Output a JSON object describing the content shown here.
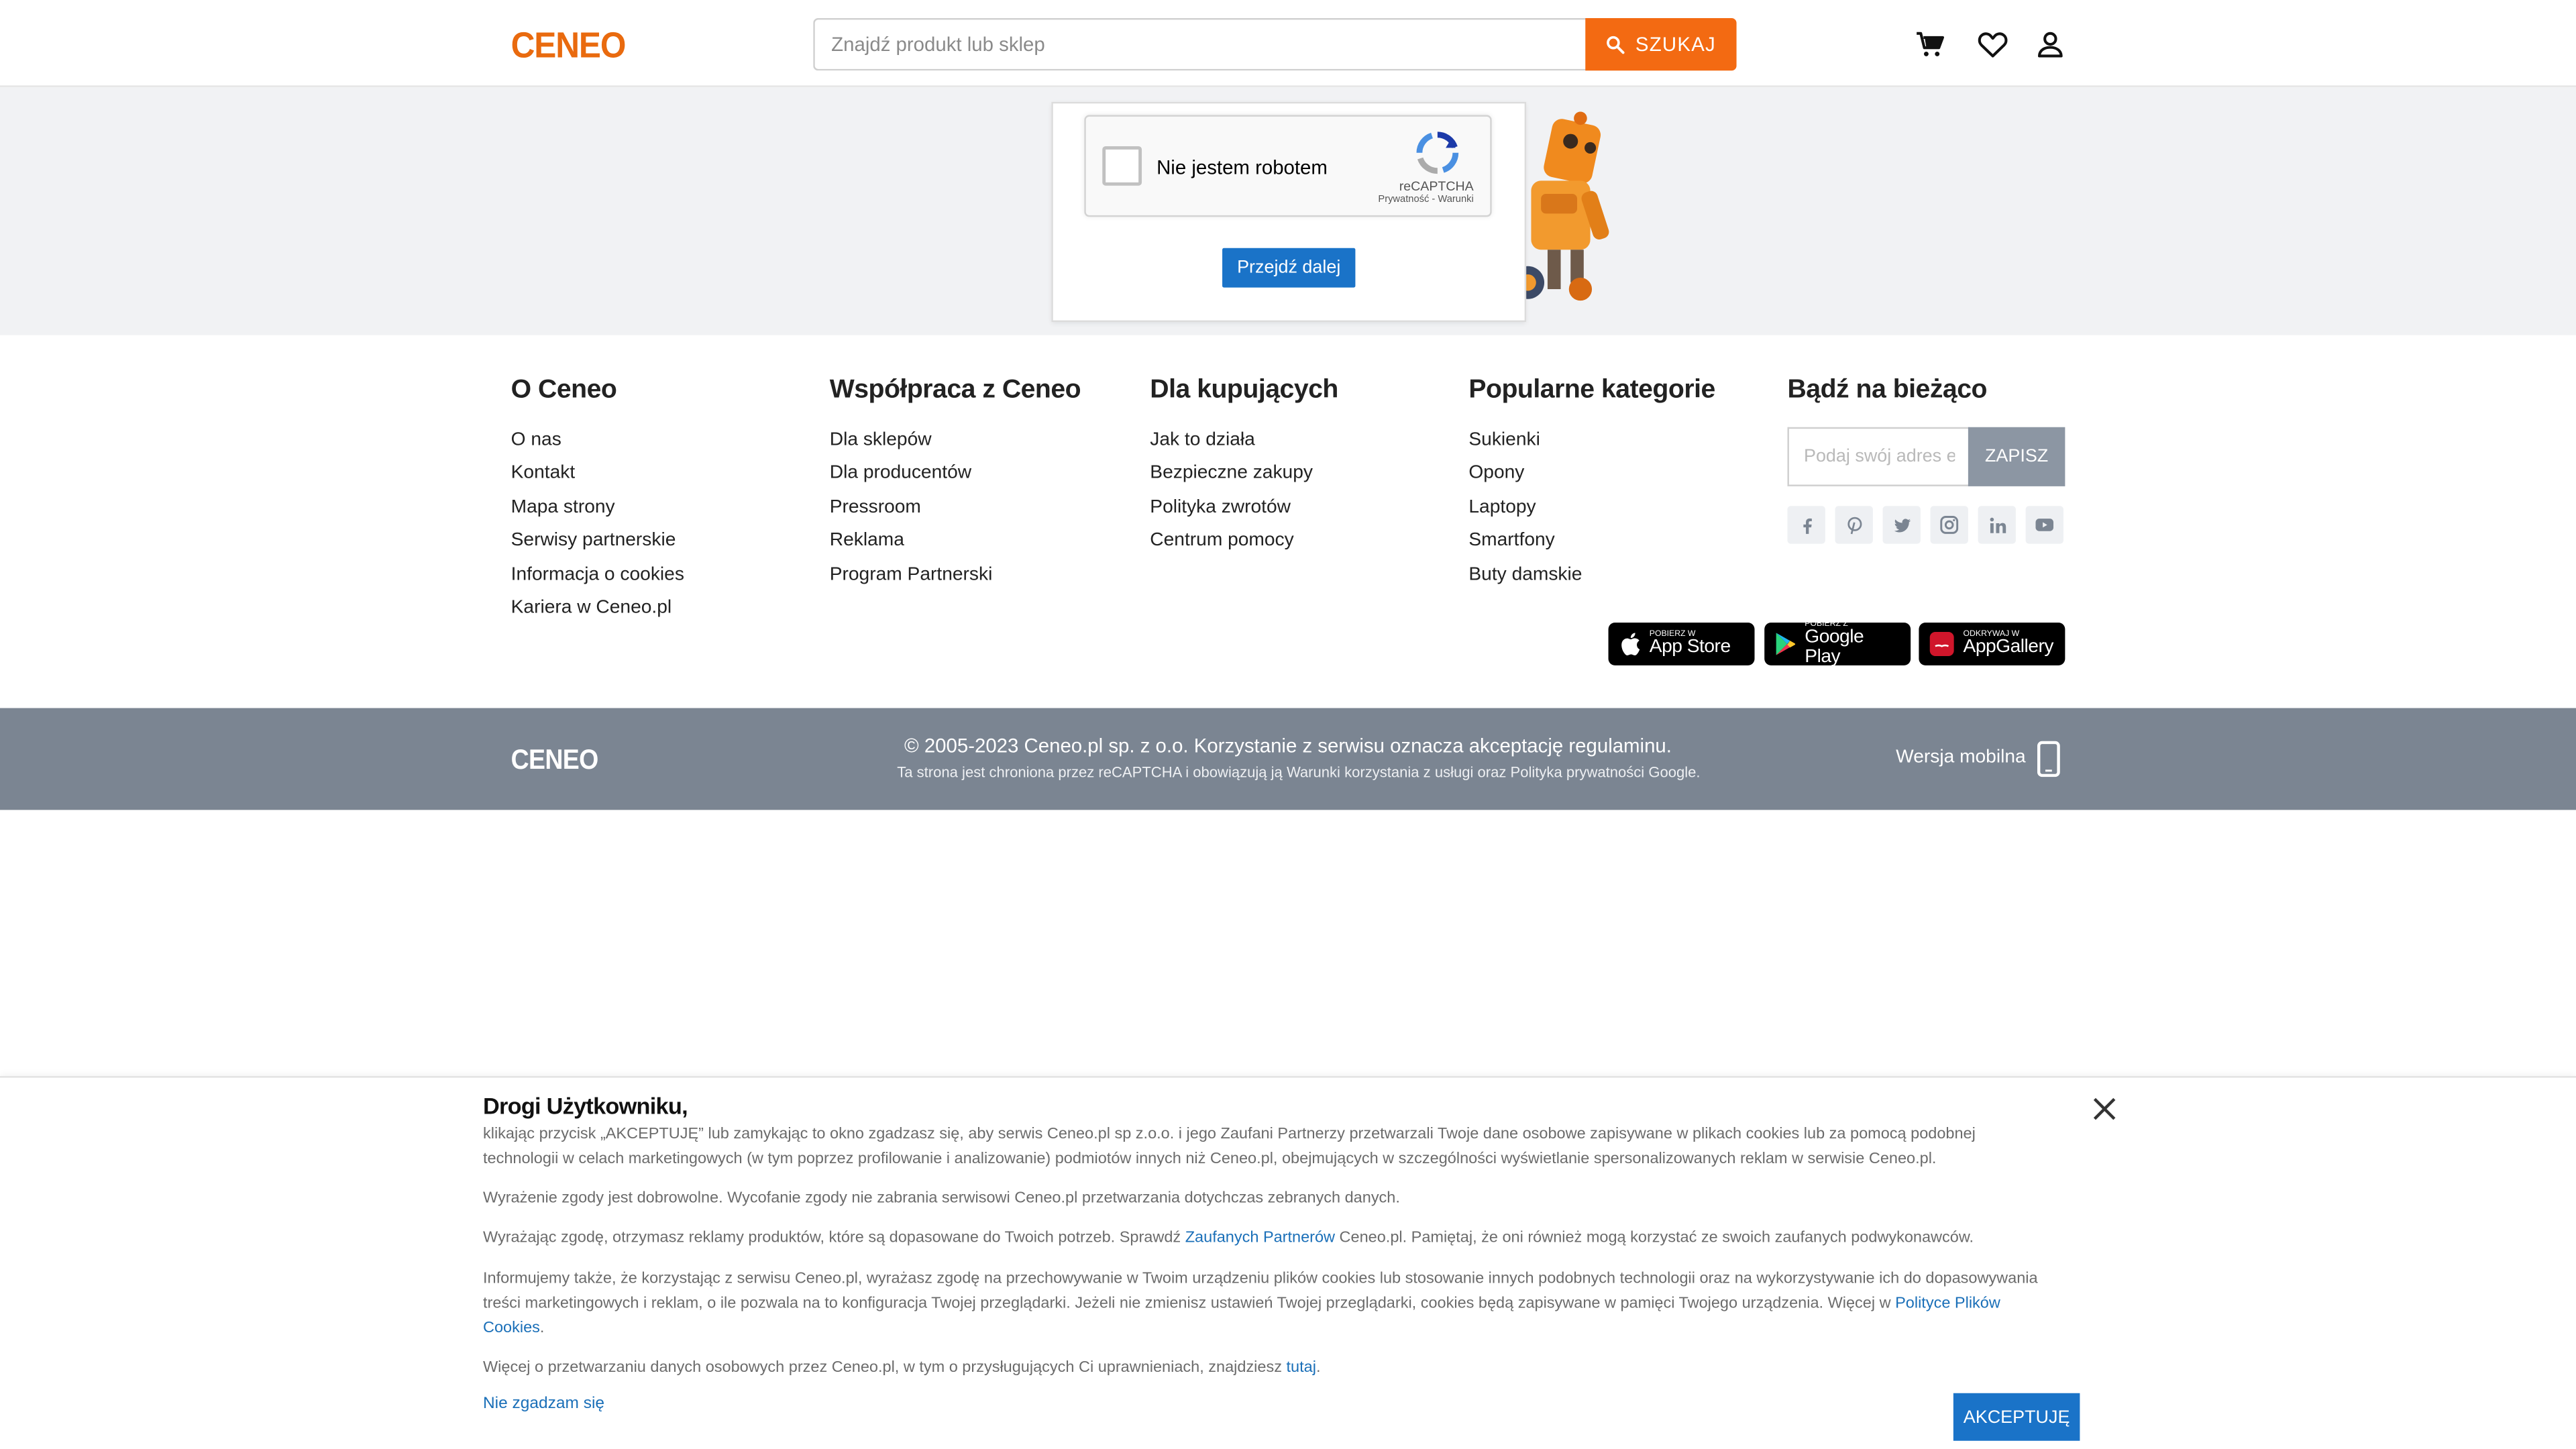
{
  "header": {
    "logo": "CENEO",
    "search_placeholder": "Znajdź produkt lub sklep",
    "search_button": "SZUKAJ"
  },
  "captcha": {
    "checkbox_label": "Nie jestem robotem",
    "brand": "reCAPTCHA",
    "links": "Prywatność - Warunki",
    "continue_button": "Przejdź dalej"
  },
  "footer": {
    "columns": [
      {
        "title": "O Ceneo",
        "items": [
          "O nas",
          "Kontakt",
          "Mapa strony",
          "Serwisy partnerskie",
          "Informacja o cookies",
          "Kariera w Ceneo.pl"
        ]
      },
      {
        "title": "Współpraca z Ceneo",
        "items": [
          "Dla sklepów",
          "Dla producentów",
          "Pressroom",
          "Reklama",
          "Program Partnerski"
        ]
      },
      {
        "title": "Dla kupujących",
        "items": [
          "Jak to działa",
          "Bezpieczne zakupy",
          "Polityka zwrotów",
          "Centrum pomocy"
        ]
      },
      {
        "title": "Popularne kategorie",
        "items": [
          "Sukienki",
          "Opony",
          "Laptopy",
          "Smartfony",
          "Buty damskie"
        ]
      }
    ],
    "newsletter": {
      "title": "Bądź na bieżąco",
      "placeholder": "Podaj swój adres e-mail",
      "button": "ZAPISZ"
    },
    "stores": [
      {
        "small": "Pobierz w",
        "big": "App Store"
      },
      {
        "small": "POBIERZ Z",
        "big": "Google Play"
      },
      {
        "small": "ODKRYWAJ W",
        "big": "AppGallery"
      }
    ]
  },
  "bottom_bar": {
    "logo": "CENEO",
    "copyright": "© 2005-2023 Ceneo.pl sp. z o.o. Korzystanie z serwisu oznacza akceptację regulaminu.",
    "recaptcha_note": "Ta strona jest chroniona przez reCAPTCHA i obowiązują ją Warunki korzystania z usługi oraz Polityka prywatności Google.",
    "mobile_version": "Wersja mobilna"
  },
  "cookie": {
    "title": "Drogi Użytkowniku,",
    "p1": "klikając przycisk „AKCEPTUJĘ” lub zamykając to okno zgadzasz się, aby serwis Ceneo.pl sp z.o.o. i jego Zaufani Partnerzy przetwarzali Twoje dane osobowe zapisywane w plikach cookies lub za pomocą podobnej technologii w celach marketingowych (w tym poprzez profilowanie i analizowanie) podmiotów innych niż Ceneo.pl, obejmujących w szczególności wyświetlanie spersonalizowanych reklam w serwisie Ceneo.pl.",
    "p2": "Wyrażenie zgody jest dobrowolne. Wycofanie zgody nie zabrania serwisowi Ceneo.pl przetwarzania dotychczas zebranych danych.",
    "p3_before": "Wyrażając zgodę, otrzymasz reklamy produktów, które są dopasowane do Twoich potrzeb. Sprawdź ",
    "p3_link": "Zaufanych Partnerów",
    "p3_after": " Ceneo.pl. Pamiętaj, że oni również mogą korzystać ze swoich zaufanych podwykonawców.",
    "p4_before": "Informujemy także, że korzystając z serwisu Ceneo.pl, wyrażasz zgodę na przechowywanie w Twoim urządzeniu plików cookies lub stosowanie innych podobnych technologii oraz na wykorzystywanie ich do dopasowywania treści marketingowych i reklam, o ile pozwala na to konfiguracja Twojej przeglądarki. Jeżeli nie zmienisz ustawień Twojej przeglądarki, cookies będą zapisywane w pamięci Twojego urządzenia. Więcej w ",
    "p4_link": "Polityce Plików Cookies",
    "p4_after": ".",
    "p5_before": "Więcej o przetwarzaniu danych osobowych przez Ceneo.pl, w tym o przysługujących Ci uprawnieniach, znajdziesz ",
    "p5_link": "tutaj",
    "p5_after": ".",
    "decline": "Nie zgadzam się",
    "accept": "AKCEPTUJĘ"
  }
}
